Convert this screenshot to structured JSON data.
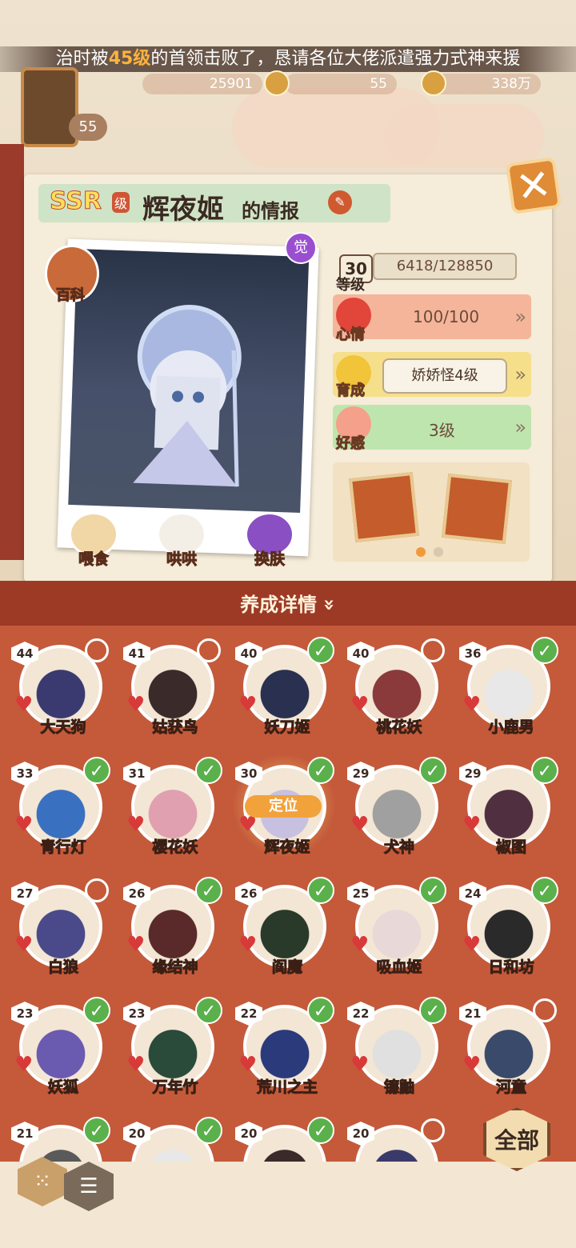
{
  "banner": {
    "pre": "治时被",
    "highlight": "45级",
    "post": "的首领击败了，恳请各位大佬派遣强力式神来援"
  },
  "resources": {
    "r1": "25901",
    "r2": "55",
    "r3": "338万",
    "player_level": "55"
  },
  "info": {
    "rarity": "SSR",
    "rarity_suffix": "级",
    "name": "辉夜姬",
    "name_suffix": "的情报",
    "baike": "百科",
    "awaken": "觉",
    "level": "30",
    "level_label": "等级",
    "exp": "6418/128850",
    "mood_label": "心情",
    "mood": "100/100",
    "growth_label": "育成",
    "growth": "娇娇怪4级",
    "fav_label": "好感",
    "fav": "3级",
    "actions": [
      "喂食",
      "哄哄",
      "换肤"
    ]
  },
  "colors": {
    "mood": "#f5b59a",
    "growth": "#f6df8a",
    "fav": "#bfe5ae",
    "check": "#5ab04a"
  },
  "section": {
    "title": "养成详情",
    "chevron": "»"
  },
  "cards": [
    {
      "level": "44",
      "name": "大天狗",
      "status": "pending",
      "color": "#3a3a70"
    },
    {
      "level": "41",
      "name": "姑获鸟",
      "status": "pending",
      "color": "#3a2a2a"
    },
    {
      "level": "40",
      "name": "妖刀姬",
      "status": "done",
      "color": "#2a3050"
    },
    {
      "level": "40",
      "name": "桃花妖",
      "status": "pending",
      "color": "#8a3a3a"
    },
    {
      "level": "36",
      "name": "小鹿男",
      "status": "done",
      "color": "#e8e8e8"
    },
    {
      "level": "33",
      "name": "青行灯",
      "status": "done",
      "color": "#3a70c0"
    },
    {
      "level": "31",
      "name": "樱花妖",
      "status": "done",
      "color": "#e0a0b0"
    },
    {
      "level": "30",
      "name": "辉夜姬",
      "status": "done",
      "color": "#c8c0e0"
    },
    {
      "level": "29",
      "name": "犬神",
      "status": "done",
      "color": "#a0a0a0"
    },
    {
      "level": "29",
      "name": "椒图",
      "status": "done",
      "color": "#503040"
    },
    {
      "level": "27",
      "name": "白狼",
      "status": "pending",
      "color": "#4a4a8a"
    },
    {
      "level": "26",
      "name": "缘结神",
      "status": "done",
      "color": "#5a2a2a"
    },
    {
      "level": "26",
      "name": "阎魔",
      "status": "done",
      "color": "#2a3a2a"
    },
    {
      "level": "25",
      "name": "吸血姬",
      "status": "done",
      "color": "#e8d8d8"
    },
    {
      "level": "24",
      "name": "日和坊",
      "status": "done",
      "color": "#2a2a2a"
    },
    {
      "level": "23",
      "name": "妖狐",
      "status": "done",
      "color": "#6a5ab0"
    },
    {
      "level": "23",
      "name": "万年竹",
      "status": "done",
      "color": "#2a4a3a"
    },
    {
      "level": "22",
      "name": "荒川之主",
      "status": "done",
      "color": "#2a3a7a"
    },
    {
      "level": "22",
      "name": "镰鼬",
      "status": "done",
      "color": "#e0e0e0"
    },
    {
      "level": "21",
      "name": "河童",
      "status": "pending",
      "color": "#3a4a6a"
    },
    {
      "level": "21",
      "name": "",
      "status": "done",
      "color": "#5a5a5a"
    },
    {
      "level": "20",
      "name": "",
      "status": "done",
      "color": "#e8e8e8"
    },
    {
      "level": "20",
      "name": "",
      "status": "done",
      "color": "#3a2a2a"
    },
    {
      "level": "20",
      "name": "",
      "status": "pending",
      "color": "#3a3a6a"
    }
  ],
  "locate_label": "定位",
  "filter_label": "全部"
}
